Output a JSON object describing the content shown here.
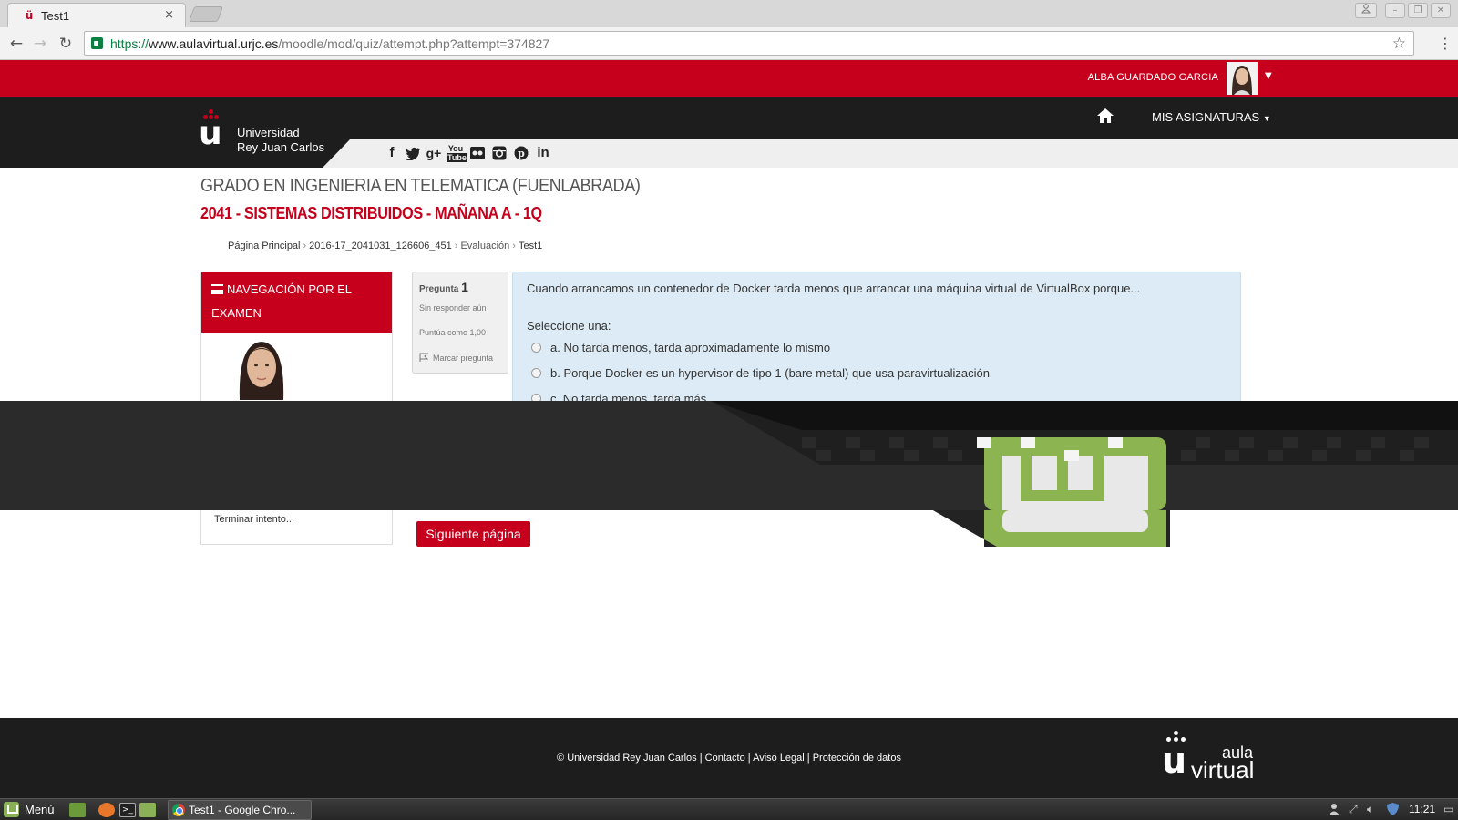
{
  "browser": {
    "tab_title": "Test1",
    "tab_close": "×",
    "url_scheme": "https://",
    "url_host": "www.aulavirtual.urjc.es",
    "url_path": "/moodle/mod/quiz/attempt.php?attempt=374827"
  },
  "site": {
    "user_name": "ALBA GUARDADO GARCIA",
    "logo_line1": "Universidad",
    "logo_line2": "Rey Juan Carlos",
    "nav_asignaturas": "MIS ASIGNATURAS",
    "social_icons": [
      "facebook-icon",
      "twitter-icon",
      "google-plus-icon",
      "youtube-icon",
      "flickr-icon",
      "instagram-icon",
      "pinterest-icon",
      "linkedin-icon"
    ],
    "brand_red": "#c6001c"
  },
  "course": {
    "title": "GRADO EN INGENIERIA EN TELEMATICA (FUENLABRADA)",
    "subtitle": "2041 - SISTEMAS DISTRIBUIDOS - MAÑANA A - 1Q"
  },
  "breadcrumb": [
    "Página Principal",
    "2016-17_2041031_126606_451",
    "Evaluación",
    "Test1"
  ],
  "quiz_nav": {
    "heading": "NAVEGACIÓN POR EL EXAMEN",
    "finish": "Terminar intento..."
  },
  "question": {
    "label": "Pregunta",
    "number": "1",
    "status": "Sin responder aún",
    "score": "Puntúa como 1,00",
    "flag": "Marcar pregunta",
    "text": "Cuando arrancamos un contenedor de Docker tarda menos que  arrancar una máquina virtual de VirtualBox porque...",
    "prompt": "Seleccione una:",
    "options": [
      "a. No tarda menos, tarda aproximadamente lo mismo",
      "b. Porque Docker es un hypervisor de tipo 1 (bare metal) que usa paravirtualización",
      "c. No tarda menos, tarda más"
    ]
  },
  "next_button": "Siguiente página",
  "footer": {
    "copyright": "© Universidad Rey Juan Carlos",
    "links": [
      "Contacto",
      "Aviso Legal",
      "Protección de datos"
    ],
    "logo_aula": "aula",
    "logo_virtual": "virtual"
  },
  "taskbar": {
    "menu": "Menú",
    "task": "Test1 - Google Chro...",
    "clock": "11:21"
  }
}
